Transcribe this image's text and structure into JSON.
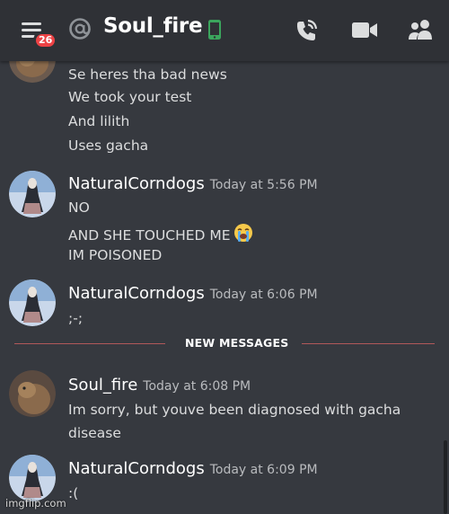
{
  "header": {
    "menu_icon": "hamburger-menu-icon",
    "notification_count": "26",
    "at_icon": "at-sign-icon",
    "channel_name": "Soul_fire",
    "status_icon": "mobile-phone-icon",
    "status_color": "#3ba55d",
    "actions": [
      {
        "name": "voice-call-icon"
      },
      {
        "name": "video-call-icon"
      },
      {
        "name": "members-icon"
      }
    ]
  },
  "messages": {
    "continued": {
      "lines": [
        "Se heres tha bad news",
        "We took your test",
        "And lilith",
        "Uses gacha"
      ]
    },
    "m1": {
      "username": "NaturalCorndogs",
      "timestamp": "Today at 5:56 PM",
      "lines": [
        "NO",
        "AND SHE TOUCHED ME",
        "IM POISONED"
      ],
      "emoji": "loudly-crying-face-emoji"
    },
    "m2": {
      "username": "NaturalCorndogs",
      "timestamp": "Today at 6:06 PM",
      "lines": [
        ";-;"
      ]
    },
    "m3": {
      "username": "Soul_fire",
      "timestamp": "Today at 6:08 PM",
      "lines": [
        "Im sorry, but youve been diagnosed with gacha",
        "disease"
      ]
    },
    "m4": {
      "username": "NaturalCorndogs",
      "timestamp": "Today at 6:09 PM",
      "lines": [
        ":("
      ]
    }
  },
  "divider": {
    "label": "NEW MESSAGES",
    "color": "#b1585a"
  },
  "watermark": "imgflip.com",
  "colors": {
    "background": "#36393f",
    "topbar": "#2f3136",
    "badge": "#ed4245"
  }
}
